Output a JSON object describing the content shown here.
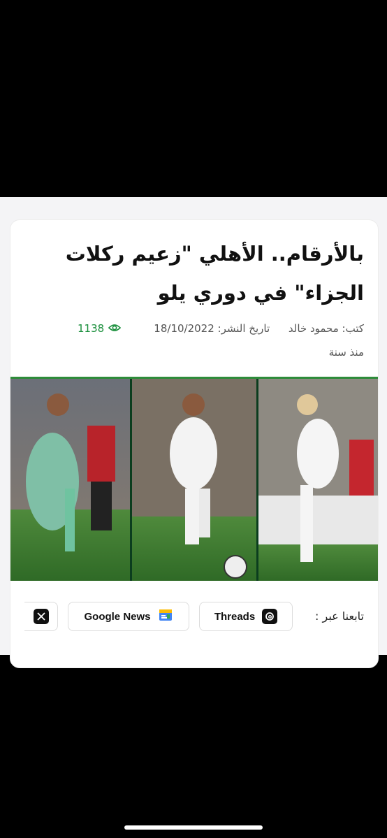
{
  "article": {
    "title": "بالأرقام.. الأهلي \"زعيم ركلات الجزاء\" في دوري يلو",
    "author": "كتب: محمود خالد",
    "publish_date": "تاريخ النشر: 18/10/2022",
    "views": "1138",
    "time_ago": "منذ سنة"
  },
  "follow": {
    "label": "تابعنا عبر :",
    "threads": "Threads",
    "google_news": "Google News"
  },
  "icons": [
    "eye-icon",
    "threads-icon",
    "google-news-icon",
    "x-icon"
  ],
  "colors": {
    "views_green": "#1a8f3c",
    "background": "#000000",
    "card": "#ffffff"
  }
}
